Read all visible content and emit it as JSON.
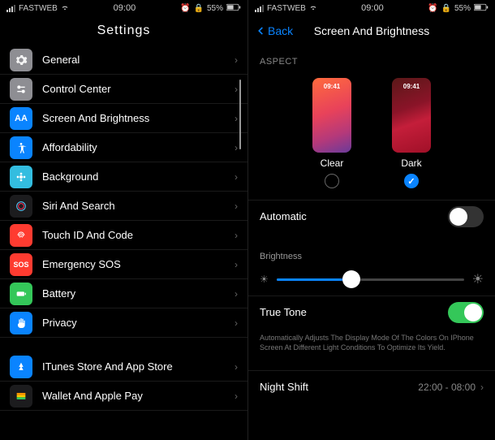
{
  "status": {
    "carrier": "FASTWEB",
    "time": "09:00",
    "battery": "55%"
  },
  "left": {
    "title": "Settings",
    "items": [
      {
        "label": "General",
        "icon": "gear",
        "bg": "#8e8e93"
      },
      {
        "label": "Control Center",
        "icon": "switches",
        "bg": "#8e8e93"
      },
      {
        "label": "Screen And Brightness",
        "icon": "aa",
        "bg": "#0a84ff"
      },
      {
        "label": "Affordability",
        "icon": "person",
        "bg": "#0a84ff"
      },
      {
        "label": "Background",
        "icon": "flower",
        "bg": "#33bde0"
      },
      {
        "label": "Siri And Search",
        "icon": "siri",
        "bg": "#1c1c1e"
      },
      {
        "label": "Touch ID And Code",
        "icon": "touchid",
        "bg": "#ff3b30"
      },
      {
        "label": "Emergency SOS",
        "icon": "sos",
        "bg": "#ff3b30"
      },
      {
        "label": "Battery",
        "icon": "battery",
        "bg": "#34c759"
      },
      {
        "label": "Privacy",
        "icon": "hand",
        "bg": "#0a84ff"
      }
    ],
    "items2": [
      {
        "label": "ITunes Store And App Store",
        "icon": "appstore",
        "bg": "#0a84ff"
      },
      {
        "label": "Wallet And Apple Pay",
        "icon": "wallet",
        "bg": "#1c1c1e"
      }
    ]
  },
  "right": {
    "back": "Back",
    "title": "Screen And Brightness",
    "aspect_header": "ASPECT",
    "thumb_time": "09:41",
    "clear_label": "Clear",
    "dark_label": "Dark",
    "automatic_label": "Automatic",
    "brightness_label": "Brightness",
    "brightness_value": 40,
    "truetone_label": "True Tone",
    "truetone_note": "Automatically Adjusts The Display Mode Of The Colors On IPhone Screen At Different Light Conditions To Optimize Its Yield.",
    "nightshift_label": "Night Shift",
    "nightshift_value": "22:00 - 08:00"
  }
}
